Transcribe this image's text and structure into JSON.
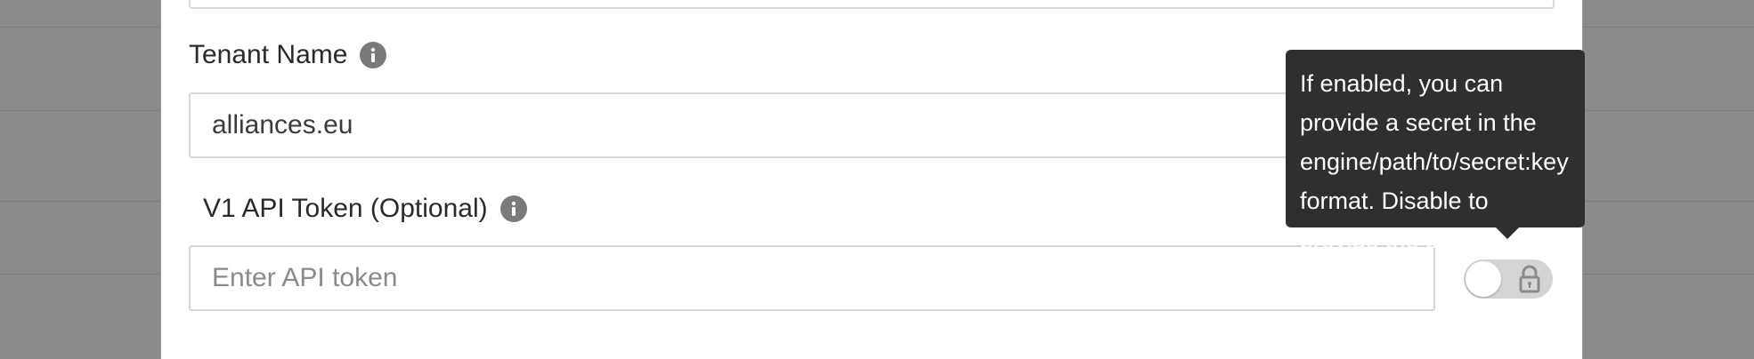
{
  "form": {
    "tenant_label": "Tenant Name",
    "tenant_value": "alliances.eu",
    "token_label": "V1 API Token (Optional)",
    "token_placeholder": "Enter API token"
  },
  "tooltip": {
    "text": "If enabled, you can provide a secret in the engine/path/to/secret:key format. Disable to provide the password directly."
  },
  "toggle": {
    "state": "off",
    "icon": "lock-icon"
  },
  "icons": {
    "info": "info-icon",
    "lock": "lock-icon"
  },
  "colors": {
    "overlay": "#8b8b8b",
    "tooltip_bg": "#2f2f2f",
    "toggle_bg": "#d4d4d4"
  }
}
